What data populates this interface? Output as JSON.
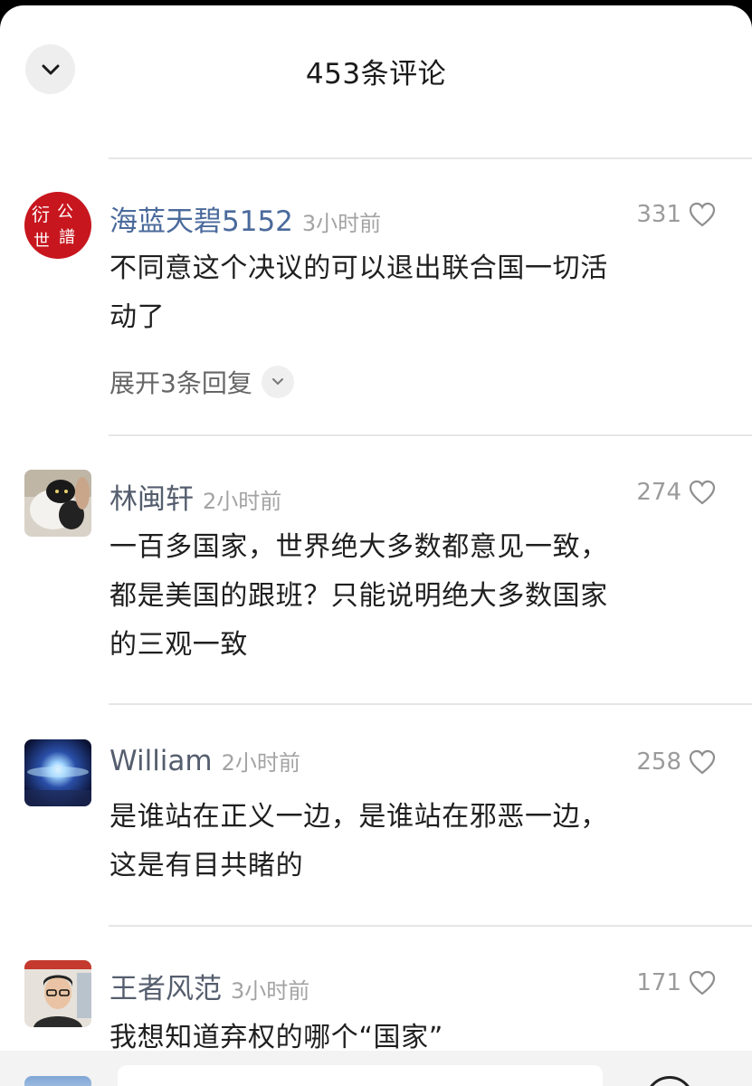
{
  "header": {
    "title": "453条评论",
    "collapse_icon": "chevron-down-icon"
  },
  "comments": [
    {
      "username": "海蓝天碧5152",
      "time": "3小时前",
      "likes": "331",
      "lines": [
        "不同意这个决议的可以退出联合国一切活",
        "动了"
      ],
      "replies": "展开3条回复",
      "avatar": "red-seal-avatar"
    },
    {
      "username": "林闽轩",
      "time": "2小时前",
      "likes": "274",
      "lines": [
        "一百多国家，世界绝大多数都意见一致，",
        "都是美国的跟班？只能说明绝大多数国家",
        "的三观一致"
      ],
      "avatar": "cat-photo-avatar"
    },
    {
      "username": "William",
      "time": "2小时前",
      "likes": "258",
      "lines": [
        "是谁站在正义一边，是谁站在邪恶一边，",
        "这是有目共睹的"
      ],
      "avatar": "galaxy-avatar"
    },
    {
      "username": "王者风范",
      "time": "3小时前",
      "likes": "171",
      "lines": [
        "我想知道弃权的哪个“国家”"
      ],
      "avatar": "man-photo-avatar"
    }
  ],
  "colors": {
    "username_blue": "#4a6a9c",
    "username_gray": "#555e6e",
    "meta_gray": "#a3a3a3"
  }
}
